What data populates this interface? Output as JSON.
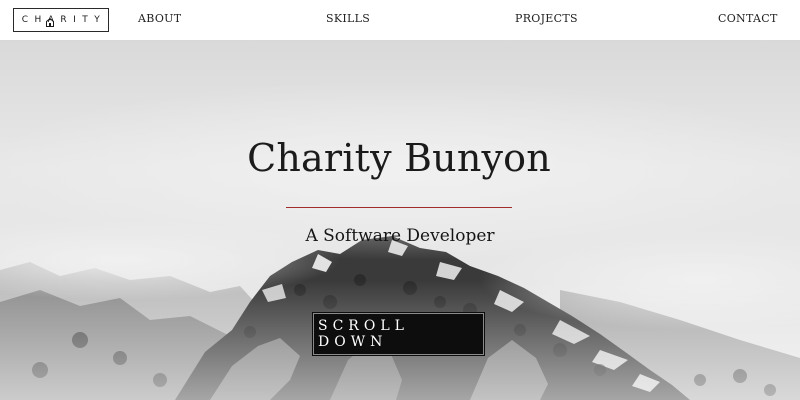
{
  "logo": {
    "text": "CHARITY"
  },
  "nav": {
    "about": "ABOUT",
    "skills": "SKILLS",
    "projects": "PROJECTS",
    "contact": "CONTACT"
  },
  "hero": {
    "title": "Charity Bunyon",
    "subtitle": "A Software Developer",
    "button_label": "SCROLL DOWN",
    "background": "misty-mountain-photo",
    "accent_color": "#a02c2c"
  }
}
